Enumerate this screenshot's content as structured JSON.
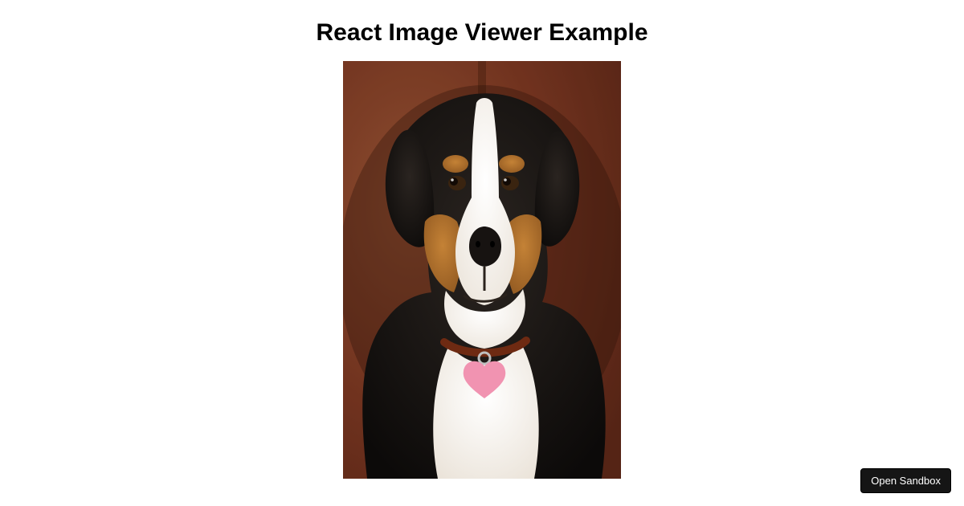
{
  "title": "React Image Viewer Example",
  "image": {
    "semantic_name": "dog-photo",
    "alt": "Greater Swiss Mountain Dog portrait",
    "subject": "dog",
    "breed_guess": "Greater Swiss Mountain Dog",
    "collar_tag_color": "#ec6f97",
    "background_color": "#7c3a24"
  },
  "sandbox": {
    "open_label": "Open Sandbox"
  }
}
